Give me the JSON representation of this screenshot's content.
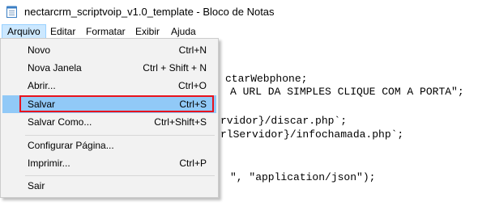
{
  "window": {
    "title": "nectarcrm_scriptvoip_v1.0_template - Bloco de Notas"
  },
  "menubar": {
    "items": [
      {
        "label": "Arquivo"
      },
      {
        "label": "Editar"
      },
      {
        "label": "Formatar"
      },
      {
        "label": "Exibir"
      },
      {
        "label": "Ajuda"
      }
    ]
  },
  "editor": {
    "lines": [
      "ctarWebphone;",
      "A URL DA SIMPLES CLIQUE COM A PORTA\";",
      "rvidor}/discar.php`;",
      "rlServidor}/infochamada.php`;",
      "\", \"application/json\");"
    ]
  },
  "file_menu": {
    "items": [
      {
        "label": "Novo",
        "shortcut": "Ctrl+N"
      },
      {
        "label": "Nova Janela",
        "shortcut": "Ctrl + Shift + N"
      },
      {
        "label": "Abrir...",
        "shortcut": "Ctrl+O"
      },
      {
        "label": "Salvar",
        "shortcut": "Ctrl+S"
      },
      {
        "label": "Salvar Como...",
        "shortcut": "Ctrl+Shift+S"
      },
      {
        "label": "Configurar Página...",
        "shortcut": ""
      },
      {
        "label": "Imprimir...",
        "shortcut": "Ctrl+P"
      },
      {
        "label": "Sair",
        "shortcut": ""
      }
    ],
    "highlighted": "Salvar"
  },
  "colors": {
    "highlight": "#91c9f7",
    "annotation_box": "#e8131e",
    "menu_active": "#cce8ff"
  },
  "icons": {
    "app": "notepad-icon"
  }
}
